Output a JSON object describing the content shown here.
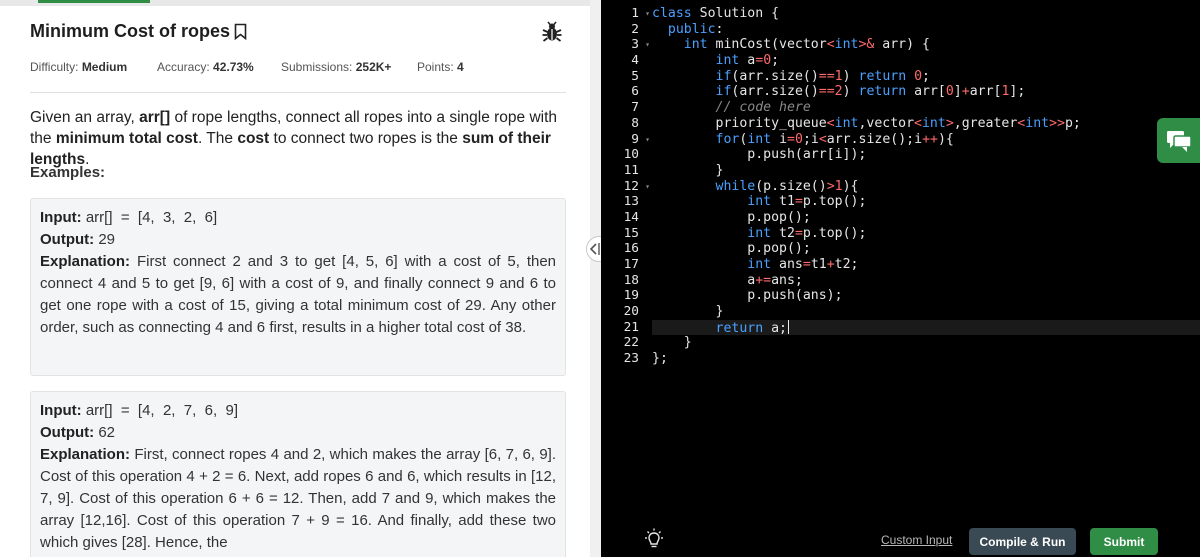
{
  "problem": {
    "title": "Minimum Cost of ropes",
    "difficulty_label": "Difficulty:",
    "difficulty": "Medium",
    "accuracy_label": "Accuracy:",
    "accuracy": "42.73%",
    "submissions_label": "Submissions:",
    "submissions": "252K+",
    "points_label": "Points:",
    "points": "4",
    "desc": {
      "p1": "Given an array, ",
      "b1": "arr[]",
      "p2": " of rope lengths, connect all ropes into a single rope with the ",
      "b2": "minimum total cost",
      "p3": ". The ",
      "b3": "cost",
      "p4": " to connect two ropes is the ",
      "b4": "sum of their lengths",
      "p5": "."
    },
    "examples_heading": "Examples:"
  },
  "examples": [
    {
      "input_label": "Input:",
      "input": "arr[]  =  [4,  3,  2,  6]",
      "output_label": "Output:",
      "output": "29",
      "explanation_label": "Explanation:",
      "explanation": "First connect 2 and 3 to get [4, 5, 6] with a cost of 5, then connect 4 and 5 to get [9, 6] with a cost of 9, and finally connect 9 and 6 to get one rope with a cost of 15, giving a total minimum cost of 29. Any other order, such as connecting 4 and 6 first, results in a higher total cost of 38."
    },
    {
      "input_label": "Input:",
      "input": "arr[]  =  [4,  2,  7,  6,  9]",
      "output_label": "Output:",
      "output": "62",
      "explanation_label": "Explanation:",
      "explanation": "First, connect ropes 4 and 2, which makes the array [6, 7, 6, 9]. Cost of this operation 4 + 2 = 6. Next, add ropes 6 and 6, which results in [12, 7, 9]. Cost of this operation 6 + 6 = 12. Then, add 7 and 9, which makes the array [12,16]. Cost of this operation 7 + 9 = 16. And finally, add these two which gives [28]. Hence, the"
    }
  ],
  "editor": {
    "line_numbers": [
      "1",
      "2",
      "3",
      "4",
      "5",
      "6",
      "7",
      "8",
      "9",
      "10",
      "11",
      "12",
      "13",
      "14",
      "15",
      "16",
      "17",
      "18",
      "19",
      "20",
      "21",
      "22",
      "23"
    ],
    "fold_lines": [
      "1",
      "3",
      "9",
      "12"
    ],
    "active_line": "21"
  },
  "footer": {
    "custom_input": "Custom Input",
    "compile_run": "Compile & Run",
    "submit": "Submit"
  },
  "colors": {
    "brand_green": "#2f8d46",
    "editor_bg": "#000000",
    "keyword_blue": "#4aa0ff",
    "literal_red": "#ff6b6b"
  },
  "icons": [
    "bookmark-icon",
    "bug-report-icon",
    "split-handle-icon",
    "chat-icon",
    "bulb-icon"
  ]
}
